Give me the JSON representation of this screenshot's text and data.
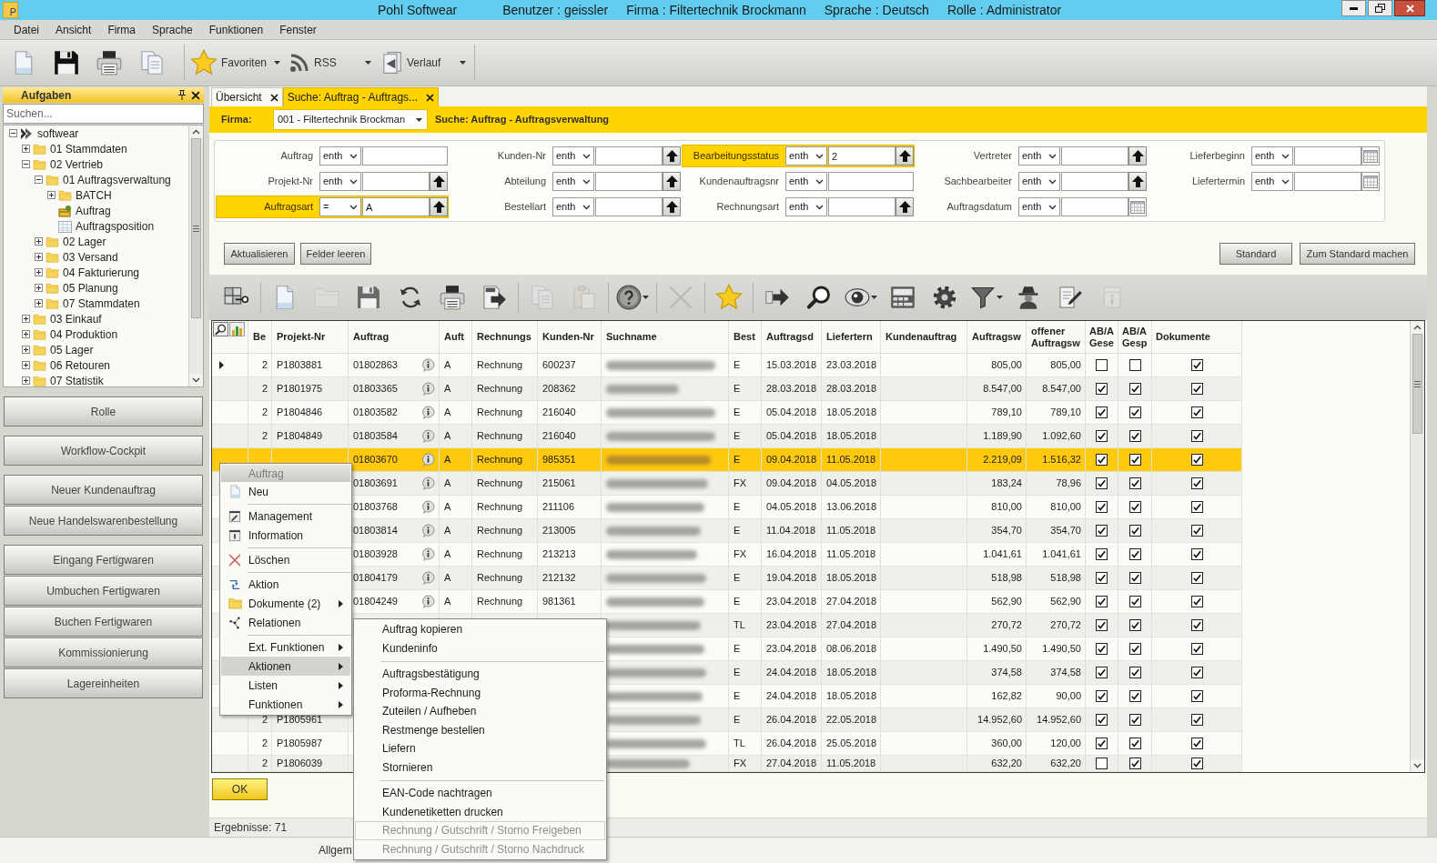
{
  "window": {
    "logo": "P",
    "title": "Pohl Softwear",
    "user": "Benutzer : geissler",
    "company": "Firma : Filtertechnik Brockmann",
    "language": "Sprache : Deutsch",
    "role": "Rolle : Administrator"
  },
  "menu": [
    "Datei",
    "Ansicht",
    "Firma",
    "Sprache",
    "Funktionen",
    "Fenster"
  ],
  "toolbar": [
    {
      "kind": "new"
    },
    {
      "kind": "save"
    },
    {
      "kind": "print"
    },
    {
      "kind": "copy"
    },
    {
      "kind": "separator"
    },
    {
      "kind": "favorites",
      "label": "Favoriten",
      "dropdown": true
    },
    {
      "kind": "rss",
      "label": "RSS",
      "dropdown": true
    },
    {
      "kind": "history",
      "label": "Verlauf",
      "dropdown": true
    }
  ],
  "sidebar": {
    "title": "Aufgaben",
    "search": {
      "placeholder": "Suchen..."
    },
    "tree": [
      {
        "label": "softwear",
        "kind": "root",
        "expanded": true,
        "children": [
          {
            "label": "01 Stammdaten",
            "kind": "folder",
            "expanded": false
          },
          {
            "label": "02 Vertrieb",
            "kind": "folder",
            "expanded": true,
            "children": [
              {
                "label": "01 Auftragsverwaltung",
                "kind": "folder",
                "expanded": true,
                "children": [
                  {
                    "label": "BATCH",
                    "kind": "folder",
                    "expanded": false
                  },
                  {
                    "label": "Auftrag",
                    "kind": "entity"
                  },
                  {
                    "label": "Auftragsposition",
                    "kind": "table"
                  }
                ]
              },
              {
                "label": "02 Lager",
                "kind": "folder",
                "expanded": false
              },
              {
                "label": "03 Versand",
                "kind": "folder",
                "expanded": false
              },
              {
                "label": "04 Fakturierung",
                "kind": "folder",
                "expanded": false
              },
              {
                "label": "05 Planung",
                "kind": "folder",
                "expanded": false
              },
              {
                "label": "07 Stammdaten",
                "kind": "folder",
                "expanded": false
              }
            ]
          },
          {
            "label": "03 Einkauf",
            "kind": "folder",
            "expanded": false
          },
          {
            "label": "04 Produktion",
            "kind": "folder",
            "expanded": false
          },
          {
            "label": "05 Lager",
            "kind": "folder",
            "expanded": false
          },
          {
            "label": "06 Retouren",
            "kind": "folder",
            "expanded": false
          },
          {
            "label": "07 Statistik",
            "kind": "folder",
            "expanded": false
          }
        ]
      }
    ],
    "button_groups": [
      [
        "Rolle"
      ],
      [
        "Workflow-Cockpit"
      ],
      [
        "Neuer Kundenauftrag",
        "Neue Handelswarenbestellung"
      ],
      [
        "Eingang Fertigwaren",
        "Umbuchen Fertigwaren",
        "Buchen Fertigwaren",
        "Kommissionierung",
        "Lagereinheiten"
      ]
    ]
  },
  "tabs": [
    {
      "label": "Übersicht",
      "selected": false
    },
    {
      "label": "Suche: Auftrag - Auftrags...",
      "selected": true
    }
  ],
  "search_header": {
    "label": "Firma:",
    "company": "001 - Filtertechnik Brockman",
    "title": "Suche: Auftrag - Auftragsverwaltung"
  },
  "filters": [
    [
      {
        "label": "Auftrag",
        "operator": "enth",
        "kind": "plain",
        "active": false
      },
      {
        "label": "Projekt-Nr",
        "operator": "enth",
        "kind": "lookup",
        "active": false
      },
      {
        "label": "Auftragsart",
        "operator": "=",
        "value": "A",
        "kind": "lookup",
        "active": true
      }
    ],
    [
      {
        "label": "Kunden-Nr",
        "operator": "enth",
        "kind": "lookup",
        "active": false
      },
      {
        "label": "Abteilung",
        "operator": "enth",
        "kind": "lookup",
        "active": false
      },
      {
        "label": "Bestellart",
        "operator": "enth",
        "kind": "lookup",
        "active": false
      }
    ],
    [
      {
        "label": "Bearbeitungsstatus",
        "operator": "enth",
        "value": "2",
        "kind": "lookup",
        "active": true
      },
      {
        "label": "Kundenauftragsnr",
        "operator": "enth",
        "kind": "plain",
        "active": false
      },
      {
        "label": "Rechnungsart",
        "operator": "enth",
        "kind": "lookup",
        "active": false
      }
    ],
    [
      {
        "label": "Vertreter",
        "operator": "enth",
        "kind": "lookup",
        "active": false
      },
      {
        "label": "Sachbearbeiter",
        "operator": "enth",
        "kind": "lookup",
        "active": false
      },
      {
        "label": "Auftragsdatum",
        "operator": "enth",
        "kind": "date",
        "active": false
      }
    ],
    [
      {
        "label": "Lieferbeginn",
        "operator": "enth",
        "kind": "date",
        "active": false
      },
      {
        "label": "Liefertermin",
        "operator": "enth",
        "kind": "date",
        "active": false
      }
    ]
  ],
  "filter_actions": [
    "Aktualisieren",
    "Felder leeren"
  ],
  "layout_actions": [
    "Standard",
    "Zum Standard machen"
  ],
  "grid_toolbar": [
    {
      "kind": "grid-key",
      "disabled": false
    },
    {
      "kind": "separator"
    },
    {
      "kind": "new",
      "disabled": false
    },
    {
      "kind": "folder",
      "disabled": true
    },
    {
      "kind": "save",
      "disabled": false
    },
    {
      "kind": "refresh",
      "disabled": false
    },
    {
      "kind": "print",
      "disabled": false
    },
    {
      "kind": "pdf",
      "disabled": false
    },
    {
      "kind": "separator"
    },
    {
      "kind": "copy",
      "disabled": true
    },
    {
      "kind": "paste",
      "disabled": true
    },
    {
      "kind": "separator"
    },
    {
      "kind": "help",
      "disabled": false,
      "dropdown": true
    },
    {
      "kind": "separator"
    },
    {
      "kind": "delete",
      "disabled": true
    },
    {
      "kind": "separator"
    },
    {
      "kind": "star",
      "disabled": false
    },
    {
      "kind": "separator"
    },
    {
      "kind": "forward",
      "disabled": false
    },
    {
      "kind": "search",
      "disabled": false
    },
    {
      "kind": "view",
      "disabled": false,
      "dropdown": true
    },
    {
      "kind": "calculator",
      "disabled": false
    },
    {
      "kind": "settings",
      "disabled": false
    },
    {
      "kind": "filter",
      "disabled": false,
      "dropdown": true
    },
    {
      "kind": "agent",
      "disabled": false
    },
    {
      "kind": "edit",
      "disabled": false
    },
    {
      "kind": "info",
      "disabled": true
    }
  ],
  "table": {
    "columns": [
      {
        "label": "Be",
        "kind": "number"
      },
      {
        "label": "Projekt-Nr",
        "kind": "text"
      },
      {
        "label": "Auftrag",
        "kind": "info"
      },
      {
        "label": "Auft",
        "kind": "text"
      },
      {
        "label": "Rechnungs",
        "kind": "text"
      },
      {
        "label": "Kunden-Nr",
        "kind": "text"
      },
      {
        "label": "Suchname",
        "kind": "redacted"
      },
      {
        "label": "Best",
        "kind": "text"
      },
      {
        "label": "Auftragsd",
        "kind": "text"
      },
      {
        "label": "Liefertern",
        "kind": "text"
      },
      {
        "label": "Kundenauftrag",
        "kind": "text"
      },
      {
        "label": "Auftragsw",
        "kind": "number"
      },
      {
        "label": "offener Auftragsw",
        "kind": "number"
      },
      {
        "label": "AB/A Gese",
        "kind": "check"
      },
      {
        "label": "AB/A Gesp",
        "kind": "check"
      },
      {
        "label": "Dokumente",
        "kind": "check"
      }
    ],
    "rows": [
      {
        "current": true,
        "selected": false,
        "be": "2",
        "projekt_nr": "P1803881",
        "auftrag": "01802863",
        "auft": "A",
        "rechnungs": "Rechnung",
        "kunden_nr": "600237",
        "best": "E",
        "auftragsd": "15.03.2018",
        "liefertern": "23.03.2018",
        "auftragsw": "805,00",
        "offener_auftragsw": "805,00",
        "ab_gese": false,
        "ab_gesp": false,
        "dokumente": true
      },
      {
        "current": false,
        "selected": false,
        "be": "2",
        "projekt_nr": "P1801975",
        "auftrag": "01803365",
        "auft": "A",
        "rechnungs": "Rechnung",
        "kunden_nr": "208362",
        "best": "E",
        "auftragsd": "28.03.2018",
        "liefertern": "28.03.2018",
        "auftragsw": "8.547,00",
        "offener_auftragsw": "8.547,00",
        "ab_gese": true,
        "ab_gesp": true,
        "dokumente": true
      },
      {
        "current": false,
        "selected": false,
        "be": "2",
        "projekt_nr": "P1804846",
        "auftrag": "01803582",
        "auft": "A",
        "rechnungs": "Rechnung",
        "kunden_nr": "216040",
        "best": "E",
        "auftragsd": "05.04.2018",
        "liefertern": "18.05.2018",
        "auftragsw": "789,10",
        "offener_auftragsw": "789,10",
        "ab_gese": true,
        "ab_gesp": true,
        "dokumente": true
      },
      {
        "current": false,
        "selected": false,
        "be": "2",
        "projekt_nr": "P1804849",
        "auftrag": "01803584",
        "auft": "A",
        "rechnungs": "Rechnung",
        "kunden_nr": "216040",
        "best": "E",
        "auftragsd": "05.04.2018",
        "liefertern": "18.05.2018",
        "auftragsw": "1.189,90",
        "offener_auftragsw": "1.092,60",
        "ab_gese": true,
        "ab_gesp": true,
        "dokumente": true
      },
      {
        "current": false,
        "selected": true,
        "auftrag": "01803670",
        "auft": "A",
        "rechnungs": "Rechnung",
        "kunden_nr": "985351",
        "best": "E",
        "auftragsd": "09.04.2018",
        "liefertern": "11.05.2018",
        "auftragsw": "2.219,09",
        "offener_auftragsw": "1.516,32",
        "ab_gese": true,
        "ab_gesp": true,
        "dokumente": true
      },
      {
        "current": false,
        "selected": false,
        "auftrag": "01803691",
        "auft": "A",
        "rechnungs": "Rechnung",
        "kunden_nr": "215061",
        "best": "FX",
        "auftragsd": "09.04.2018",
        "liefertern": "04.05.2018",
        "auftragsw": "183,24",
        "offener_auftragsw": "78,96",
        "ab_gese": true,
        "ab_gesp": true,
        "dokumente": true
      },
      {
        "current": false,
        "selected": false,
        "auftrag": "01803768",
        "auft": "A",
        "rechnungs": "Rechnung",
        "kunden_nr": "211106",
        "best": "E",
        "auftragsd": "04.05.2018",
        "liefertern": "13.06.2018",
        "auftragsw": "810,00",
        "offener_auftragsw": "810,00",
        "ab_gese": true,
        "ab_gesp": true,
        "dokumente": true
      },
      {
        "current": false,
        "selected": false,
        "auftrag": "01803814",
        "auft": "A",
        "rechnungs": "Rechnung",
        "kunden_nr": "213005",
        "best": "E",
        "auftragsd": "11.04.2018",
        "liefertern": "11.05.2018",
        "auftragsw": "354,70",
        "offener_auftragsw": "354,70",
        "ab_gese": true,
        "ab_gesp": true,
        "dokumente": true
      },
      {
        "current": false,
        "selected": false,
        "auftrag": "01803928",
        "auft": "A",
        "rechnungs": "Rechnung",
        "kunden_nr": "213213",
        "best": "FX",
        "auftragsd": "16.04.2018",
        "liefertern": "11.05.2018",
        "auftragsw": "1.041,61",
        "offener_auftragsw": "1.041,61",
        "ab_gese": true,
        "ab_gesp": true,
        "dokumente": true
      },
      {
        "current": false,
        "selected": false,
        "auftrag": "01804179",
        "auft": "A",
        "rechnungs": "Rechnung",
        "kunden_nr": "212132",
        "best": "E",
        "auftragsd": "19.04.2018",
        "liefertern": "18.05.2018",
        "auftragsw": "518,98",
        "offener_auftragsw": "518,98",
        "ab_gese": true,
        "ab_gesp": true,
        "dokumente": true
      },
      {
        "current": false,
        "selected": false,
        "auftrag": "01804249",
        "auft": "A",
        "rechnungs": "Rechnung",
        "kunden_nr": "981361",
        "best": "E",
        "auftragsd": "23.04.2018",
        "liefertern": "27.04.2018",
        "auftragsw": "562,90",
        "offener_auftragsw": "562,90",
        "ab_gese": true,
        "ab_gesp": true,
        "dokumente": true
      },
      {
        "current": false,
        "selected": false,
        "best": "TL",
        "auftragsd": "23.04.2018",
        "liefertern": "27.04.2018",
        "auftragsw": "270,72",
        "offener_auftragsw": "270,72",
        "ab_gese": true,
        "ab_gesp": true,
        "dokumente": true
      },
      {
        "current": false,
        "selected": false,
        "best": "E",
        "auftragsd": "23.04.2018",
        "liefertern": "08.06.2018",
        "auftragsw": "1.490,50",
        "offener_auftragsw": "1.490,50",
        "ab_gese": true,
        "ab_gesp": true,
        "dokumente": true
      },
      {
        "current": false,
        "selected": false,
        "best": "E",
        "auftragsd": "24.04.2018",
        "liefertern": "18.05.2018",
        "auftragsw": "374,58",
        "offener_auftragsw": "374,58",
        "ab_gese": true,
        "ab_gesp": true,
        "dokumente": true
      },
      {
        "current": false,
        "selected": false,
        "best": "E",
        "auftragsd": "24.04.2018",
        "liefertern": "18.05.2018",
        "auftragsw": "162,82",
        "offener_auftragsw": "90,00",
        "ab_gese": true,
        "ab_gesp": true,
        "dokumente": true
      },
      {
        "current": false,
        "selected": false,
        "be": "2",
        "projekt_nr": "P1805961",
        "best": "E",
        "auftragsd": "26.04.2018",
        "liefertern": "22.05.2018",
        "auftragsw": "14.952,60",
        "offener_auftragsw": "14.952,60",
        "ab_gese": true,
        "ab_gesp": true,
        "dokumente": true
      },
      {
        "current": false,
        "selected": false,
        "be": "2",
        "projekt_nr": "P1805987",
        "best": "TL",
        "auftragsd": "26.04.2018",
        "liefertern": "25.05.2018",
        "auftragsw": "360,00",
        "offener_auftragsw": "120,00",
        "ab_gese": true,
        "ab_gesp": true,
        "dokumente": true
      },
      {
        "current": false,
        "selected": false,
        "be": "2",
        "projekt_nr": "P1806039",
        "best": "FX",
        "auftragsd": "27.04.2018",
        "liefertern": "11.05.2018",
        "auftragsw": "632,20",
        "offener_auftragsw": "632,20",
        "ab_gese": false,
        "ab_gesp": true,
        "dokumente": true
      }
    ]
  },
  "ok_button": "OK",
  "results": "Ergebnisse: 71",
  "status_bar": "Allgem",
  "context_menu": [
    {
      "kind": "header",
      "label": "Auftrag"
    },
    {
      "kind": "item",
      "label": "Neu",
      "submenu": false,
      "selected": false
    },
    {
      "kind": "separator"
    },
    {
      "kind": "item",
      "label": "Management",
      "submenu": false,
      "selected": false
    },
    {
      "kind": "item",
      "label": "Information",
      "submenu": false,
      "selected": false
    },
    {
      "kind": "separator"
    },
    {
      "kind": "item",
      "label": "Löschen",
      "submenu": false,
      "selected": false
    },
    {
      "kind": "separator"
    },
    {
      "kind": "item",
      "label": "Aktion",
      "submenu": false,
      "selected": false
    },
    {
      "kind": "item",
      "label": "Dokumente (2)",
      "submenu": true,
      "selected": false
    },
    {
      "kind": "item",
      "label": "Relationen",
      "submenu": false,
      "selected": false
    },
    {
      "kind": "separator"
    },
    {
      "kind": "item",
      "label": "Ext. Funktionen",
      "submenu": true,
      "selected": false
    },
    {
      "kind": "item",
      "label": "Aktionen",
      "submenu": true,
      "selected": true
    },
    {
      "kind": "item",
      "label": "Listen",
      "submenu": true,
      "selected": false
    },
    {
      "kind": "item",
      "label": "Funktionen",
      "submenu": true,
      "selected": false
    }
  ],
  "submenu": [
    {
      "kind": "item",
      "label": "Auftrag kopieren",
      "disabled": false,
      "focused": false
    },
    {
      "kind": "item",
      "label": "Kundeninfo",
      "disabled": false,
      "focused": false
    },
    {
      "kind": "separator"
    },
    {
      "kind": "item",
      "label": "Auftragsbestätigung",
      "disabled": false,
      "focused": false
    },
    {
      "kind": "item",
      "label": "Proforma-Rechnung",
      "disabled": false,
      "focused": false
    },
    {
      "kind": "item",
      "label": "Zuteilen / Aufheben",
      "disabled": false,
      "focused": false
    },
    {
      "kind": "item",
      "label": "Restmenge bestellen",
      "disabled": false,
      "focused": false
    },
    {
      "kind": "item",
      "label": "Liefern",
      "disabled": false,
      "focused": false
    },
    {
      "kind": "item",
      "label": "Stornieren",
      "disabled": false,
      "focused": false
    },
    {
      "kind": "separator"
    },
    {
      "kind": "item",
      "label": "EAN-Code nachtragen",
      "disabled": false,
      "focused": false
    },
    {
      "kind": "item",
      "label": "Kundenetiketten drucken",
      "disabled": false,
      "focused": false
    },
    {
      "kind": "item",
      "label": "Rechnung / Gutschrift / Storno Freigeben",
      "disabled": true,
      "focused": true
    },
    {
      "kind": "item",
      "label": "Rechnung / Gutschrift / Storno Nachdruck",
      "disabled": true,
      "focused": false
    }
  ]
}
